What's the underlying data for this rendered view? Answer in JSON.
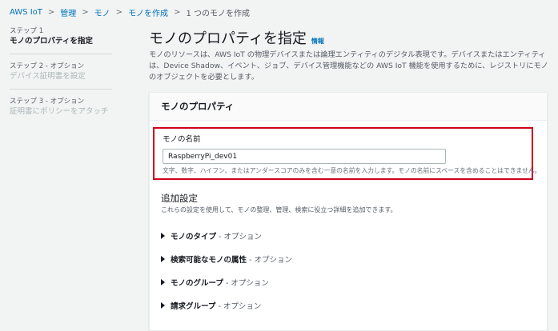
{
  "breadcrumb": {
    "items": [
      "AWS IoT",
      "管理",
      "モノ",
      "モノを作成"
    ],
    "current": "1 つのモノを作成"
  },
  "sidebar": {
    "steps": [
      {
        "num": "ステップ 1",
        "title": "モノのプロパティを指定"
      },
      {
        "num": "ステップ 2 - オプション",
        "title": "デバイス証明書を設定"
      },
      {
        "num": "ステップ 3 - オプション",
        "title": "証明書にポリシーをアタッチ"
      }
    ]
  },
  "main": {
    "title": "モノのプロパティを指定",
    "info": "情報",
    "description": "モノのリソースは、AWS IoT の物理デバイスまたは論理エンティティのデジタル表現です。デバイスまたはエンティティは、Device Shadow、イベント、ジョブ、デバイス管理機能などの AWS IoT 機能を使用するために、レジストリにモノのオブジェクトを必要とします。"
  },
  "panel": {
    "title": "モノのプロパティ",
    "name_label": "モノの名前",
    "name_value": "RaspberryPi_dev01",
    "name_hint": "文字、数字、ハイフン、またはアンダースコアのみを含む一意の名前を入力します。モノの名前にスペースを含めることはできません。",
    "additional_title": "追加設定",
    "additional_desc": "これらの設定を使用して、モノの整理、管理、検索に役立つ詳細を追加できます。",
    "expandables": [
      {
        "label": "モノのタイプ",
        "suffix": "- オプション"
      },
      {
        "label": "検索可能なモノの属性",
        "suffix": "- オプション"
      },
      {
        "label": "モノのグループ",
        "suffix": "- オプション"
      },
      {
        "label": "請求グループ",
        "suffix": "- オプション"
      }
    ]
  }
}
